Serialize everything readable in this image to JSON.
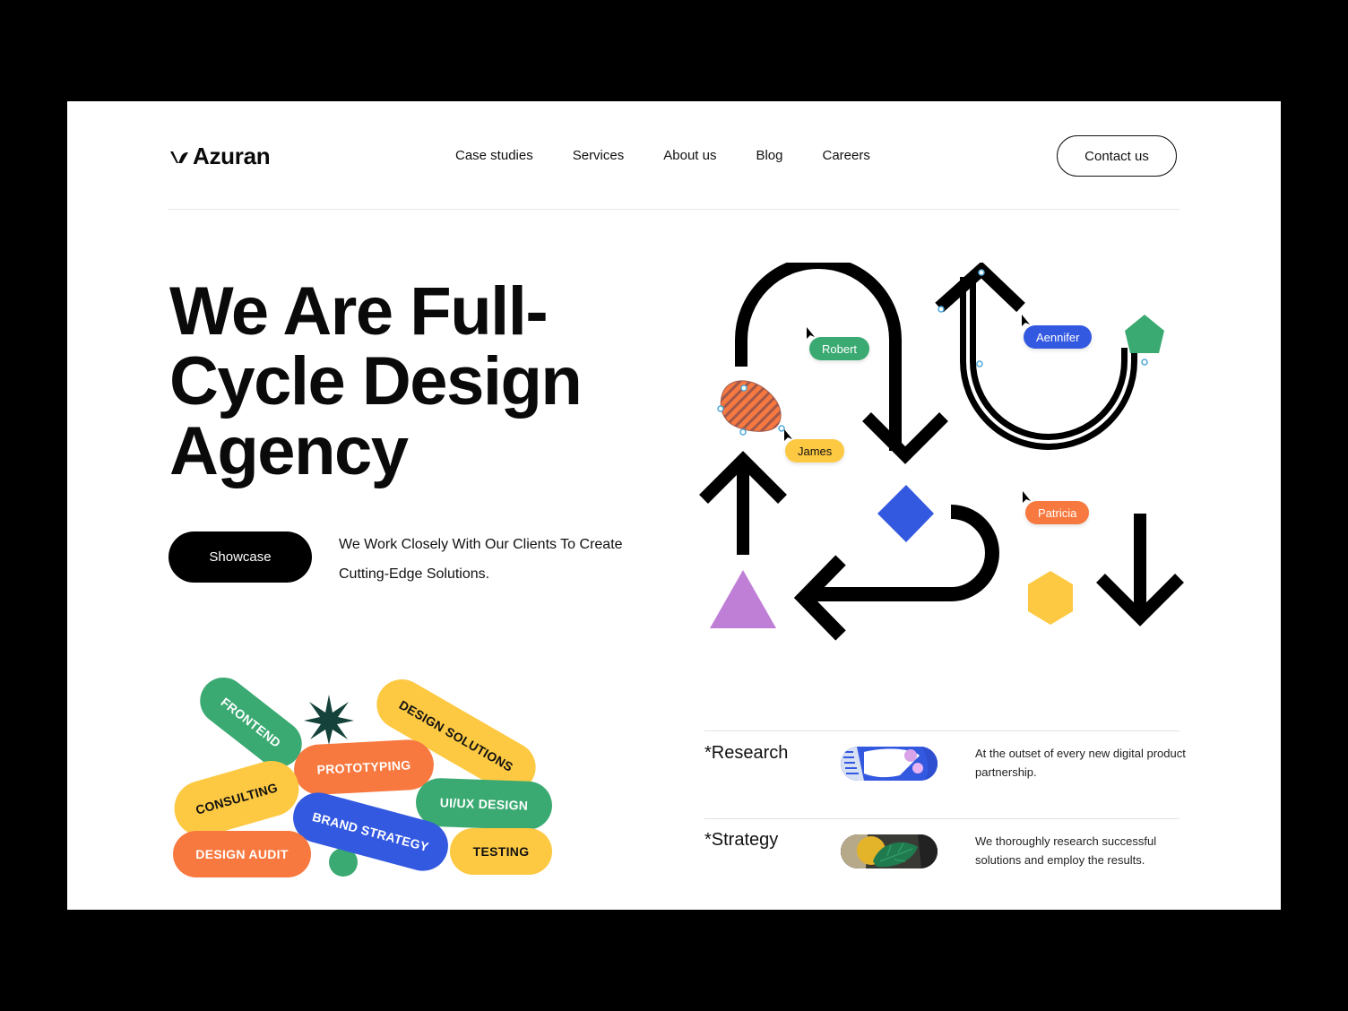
{
  "brand": {
    "name": "Azuran"
  },
  "nav": {
    "items": [
      "Case studies",
      "Services",
      "About us",
      "Blog",
      "Careers"
    ],
    "contact_label": "Contact us"
  },
  "hero": {
    "title": "We Are Full-Cycle Design Agency",
    "cta_label": "Showcase",
    "description": "We Work Closely With Our Clients To Create Cutting-Edge Solutions."
  },
  "tags": [
    "FRONTEND",
    "DESIGN SOLUTIONS",
    "PROTOTYPING",
    "CONSULTING",
    "UI/UX DESIGN",
    "BRAND STRATEGY",
    "DESIGN AUDIT",
    "TESTING"
  ],
  "collaborators": [
    "Robert",
    "Aennifer",
    "James",
    "Patricia"
  ],
  "services": [
    {
      "title": "*Research",
      "description": "At the outset of every new digital product partnership."
    },
    {
      "title": "*Strategy",
      "description": "We thoroughly research successful solutions and employ the results."
    }
  ],
  "colors": {
    "green": "#3aaa72",
    "orange": "#f7793f",
    "yellow": "#fdc942",
    "blue": "#3359e0",
    "purple": "#c07fd6",
    "dark_teal": "#15423a"
  }
}
